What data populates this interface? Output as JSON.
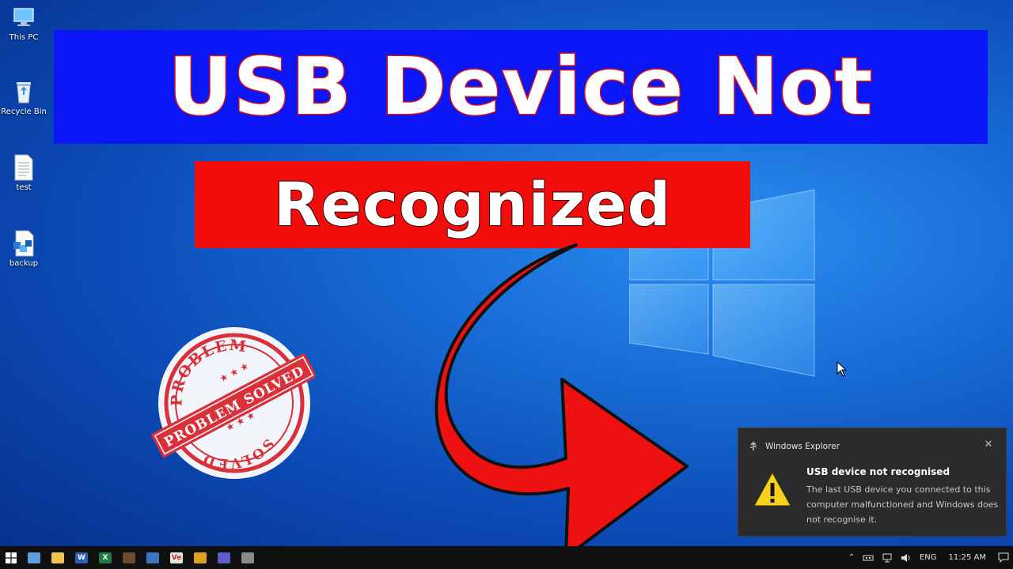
{
  "desktop": {
    "icons": [
      {
        "label": "This PC",
        "icon": "computer-icon"
      },
      {
        "label": "Recycle Bin",
        "icon": "recycle-bin-icon"
      },
      {
        "label": "test",
        "icon": "text-file-icon"
      },
      {
        "label": "backup",
        "icon": "backup-file-icon"
      }
    ]
  },
  "thumbnail": {
    "headline": "USB Device Not",
    "subline": "Recognized",
    "stamp": {
      "top_text": "PROBLEM",
      "ribbon_text": "PROBLEM SOLVED",
      "bottom_text": "SOLVED",
      "stars": "★ ★ ★"
    }
  },
  "notification": {
    "app_name": "Windows Explorer",
    "title": "USB device not recognised",
    "body": "The last USB device you connected to this computer malfunctioned and Windows does not recognise it.",
    "close_glyph": "✕"
  },
  "taskbar": {
    "apps": [
      {
        "name": "task-view",
        "letter": "",
        "color": "#5aa0e0"
      },
      {
        "name": "file-explorer",
        "letter": "",
        "color": "#f2c14e"
      },
      {
        "name": "word",
        "letter": "W",
        "color": "#2b5eb8"
      },
      {
        "name": "excel",
        "letter": "X",
        "color": "#1f7a3f"
      },
      {
        "name": "calculator",
        "letter": "",
        "color": "#6b4a2e"
      },
      {
        "name": "app-blue",
        "letter": "",
        "color": "#3b78c4"
      },
      {
        "name": "app-ve",
        "letter": "Ve",
        "color": "#e6e6e6"
      },
      {
        "name": "chrome",
        "letter": "",
        "color": "#e0a020"
      },
      {
        "name": "teams",
        "letter": "",
        "color": "#5b5fc7"
      },
      {
        "name": "app-globe",
        "letter": "",
        "color": "#8a8a8a"
      }
    ],
    "tray": {
      "language": "ENG",
      "time": "11:25 AM"
    }
  }
}
